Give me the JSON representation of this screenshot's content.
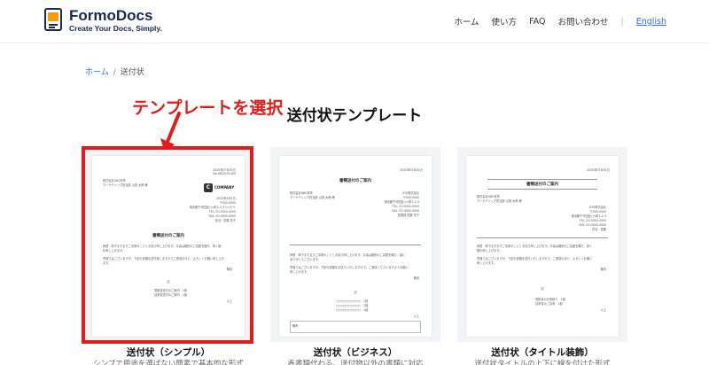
{
  "header": {
    "brand_name": "FormoDocs",
    "brand_tagline": "Create Your Docs, Simply.",
    "nav": [
      "ホーム",
      "使い方",
      "FAQ",
      "お問い合わせ"
    ],
    "separator": "|",
    "lang": "English"
  },
  "breadcrumb": {
    "home": "ホーム",
    "separator": "/",
    "current": "送付状"
  },
  "annotation": {
    "text": "テンプレートを選択",
    "color": "#e51a1a"
  },
  "page_title": "送付状テンプレート",
  "cards": [
    {
      "label": "送付状（シンプル）",
      "desc": "シンプで用途を選ばない簡素で基本的な形式",
      "doc": {
        "date": "2020年07月01日",
        "docno": "No.0620101400",
        "to_company": "株式会社ABC商事",
        "to_person": "マーケティング担当部 山田 太郎 様",
        "company_logo": "COMPANY",
        "sender": [
          "2020年4月1日",
          "〒000-0000",
          "東京都千代田区○○町1-2-3 ○○ビル",
          "TEL. 00-0000-0000",
          "FAX. 00-0000-0000",
          "担当：佐藤 花子"
        ],
        "subject": "書類送付のご案内",
        "body": [
          "拝啓　時下ますますご清栄のこととお喜び申し上げます。平素は格別のご高配を賜り、厚く御",
          "礼申し上げます。",
          "早速ではございますが、下記の書類を送付致しますのでご査収のほど、よろしくお願い申し上げ",
          "ます。"
        ],
        "closing": "敬具",
        "ki": "記",
        "items": [
          "見積書送付のご案内　1部",
          "請求書送付のご案内　1部"
        ],
        "end": "以上"
      }
    },
    {
      "label": "送付状（ビジネス）",
      "desc": "表書類代わる、送付物以外の書類に対応",
      "doc": {
        "date": "2020年07月01日",
        "subject": "書類送付のご案内",
        "to_company": "株式会社ABC商事",
        "to_person": "マーケティング担当部 山田 太郎 様",
        "sender": [
          "XYZ株式会社",
          "〒000-0000",
          "東京都千代田区○○町1-2-3",
          "TEL. 00-0000-0000",
          "FAX. 00-0000-0000",
          "営業部 佐藤 花子"
        ],
        "body": [
          "拝啓　時下ますますご清栄のこととお喜び申し上げます。平素は格別のご高配を賜り、誠に",
          "ありがとうございます。",
          "早速ではございますが、下記の書類をお送りいたしますので、ご査収くださいますようお願い",
          "申し上げます。"
        ],
        "closing": "敬具",
        "ki": "記",
        "items": [
          "○○○○○○○○○○　1部",
          "○○○○○○○○○○　1部",
          "○○○○○○○○○○　1部"
        ],
        "end": "以上",
        "note": "備考："
      }
    },
    {
      "label": "送付状（タイトル装飾）",
      "desc": "送付状タイトルの上下に線を付けた形式",
      "doc": {
        "date": "2020年07月01日",
        "subject": "書類送付のご案内",
        "to_company": "株式会社ABC商事",
        "to_person": "マーケティング担当部 山田 太郎 様",
        "sender": [
          "XYZ株式会社",
          "〒000-0000",
          "東京都千代田区○○町1-2-3",
          "TEL. 00-0000-0000",
          "FAX. 00-0000-0000",
          "担当：佐藤"
        ],
        "body": [
          "拝啓　時下ますますご清栄のこととお喜び申し上げます。平素は格別のご高配を賜り、厚く",
          "御礼申し上げます。",
          "早速ではございますが、下記の書類を送付いたしますので、ご査収のほど、よろしくお願い",
          "申し上げます。"
        ],
        "closing": "敬具",
        "ki": "記",
        "items": [
          "見積書のお見積り　1部",
          "請求書のご請求　1部"
        ],
        "end": "以上"
      }
    }
  ]
}
